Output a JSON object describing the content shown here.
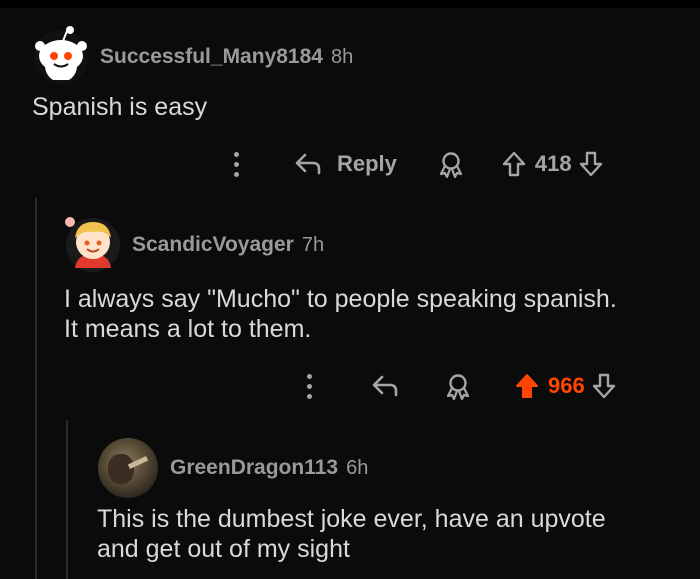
{
  "colors": {
    "background": "#0b0b0c",
    "text": "#d7dadc",
    "meta": "#9a9a9c",
    "upvote_active": "#ff4500"
  },
  "comments": [
    {
      "username": "Successful_Many8184",
      "time": "8h",
      "body": "Spanish is easy",
      "reply_label": "Reply",
      "votes": "418",
      "upvoted": false,
      "avatar": "snoo-default-avatar-icon"
    },
    {
      "username": "ScandicVoyager",
      "time": "7h",
      "body_lines": [
        "I always say \"Mucho\" to people speaking spanish.",
        "It means a lot to them."
      ],
      "votes": "966",
      "upvoted": true,
      "avatar": "snoo-blonde-avatar-icon"
    },
    {
      "username": "GreenDragon113",
      "time": "6h",
      "body_lines": [
        "This is the dumbest joke ever, have an upvote",
        "and get out of my sight"
      ],
      "avatar": "photo-avatar-icon"
    }
  ]
}
